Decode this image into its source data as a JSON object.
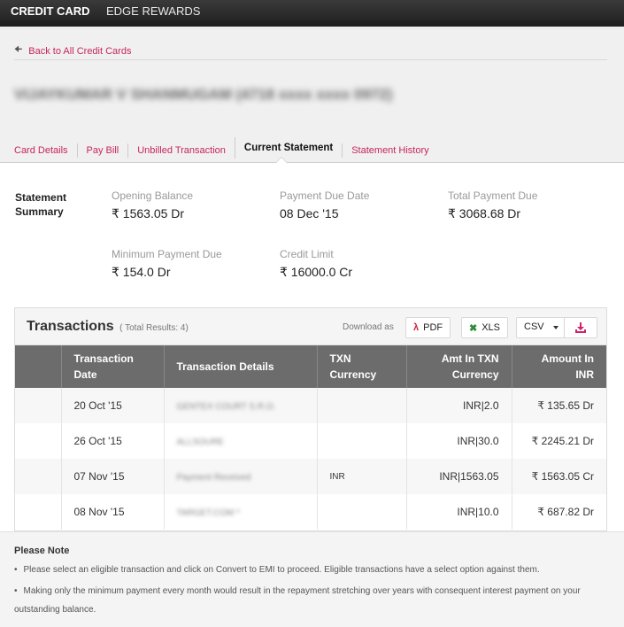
{
  "topnav": {
    "tabs": [
      {
        "label": "CREDIT CARD",
        "active": true
      },
      {
        "label": "EDGE REWARDS",
        "active": false
      }
    ]
  },
  "header": {
    "back_link": "Back to All Credit Cards",
    "card_name": "VIJAYKUMAR V SHANMUGAM (4718 xxxx xxxx 0972)",
    "subtabs": [
      {
        "label": "Card Details",
        "active": false
      },
      {
        "label": "Pay Bill",
        "active": false
      },
      {
        "label": "Unbilled Transaction",
        "active": false
      },
      {
        "label": "Current Statement",
        "active": true
      },
      {
        "label": "Statement History",
        "active": false
      }
    ]
  },
  "summary": {
    "title_line1": "Statement",
    "title_line2": "Summary",
    "items": [
      {
        "label": "Opening Balance",
        "value": "₹ 1563.05 Dr"
      },
      {
        "label": "Payment Due Date",
        "value": "08 Dec '15"
      },
      {
        "label": "Total Payment Due",
        "value": "₹ 3068.68 Dr"
      },
      {
        "label": "Minimum Payment Due",
        "value": "₹ 154.0 Dr"
      },
      {
        "label": "Credit Limit",
        "value": "₹ 16000.0 Cr"
      }
    ]
  },
  "transactions": {
    "title": "Transactions",
    "total_results": "( Total Results: 4)",
    "download_label": "Download as",
    "pdf_label": "PDF",
    "xls_label": "XLS",
    "format_selected": "CSV",
    "columns": [
      {
        "line1": "",
        "line2": ""
      },
      {
        "line1": "Transaction",
        "line2": "Date"
      },
      {
        "line1": "Transaction Details",
        "line2": ""
      },
      {
        "line1": "TXN",
        "line2": "Currency"
      },
      {
        "line1": "Amt In TXN",
        "line2": "Currency"
      },
      {
        "line1": "Amount In",
        "line2": "INR"
      }
    ],
    "rows": [
      {
        "date": "20 Oct '15",
        "details": "GENTEX COURT S.R.O.",
        "currency": "",
        "amt_txn": "INR|2.0",
        "amt_inr": "₹ 135.65 Dr"
      },
      {
        "date": "26 Oct '15",
        "details": "ALLSOURE",
        "currency": "",
        "amt_txn": "INR|30.0",
        "amt_inr": "₹ 2245.21 Dr"
      },
      {
        "date": "07 Nov '15",
        "details": "Payment Received",
        "currency": "INR",
        "amt_txn": "INR|1563.05",
        "amt_inr": "₹ 1563.05 Cr"
      },
      {
        "date": "08 Nov '15",
        "details": "TARGET.COM *",
        "currency": "",
        "amt_txn": "INR|10.0",
        "amt_inr": "₹ 687.82 Dr"
      }
    ]
  },
  "note": {
    "title": "Please Note",
    "items": [
      "Please select an eligible transaction and click on Convert to EMI to proceed. Eligible transactions have a select option against them.",
      "Making only the minimum payment every month would result in the repayment stretching over years with consequent interest payment on your outstanding balance."
    ]
  },
  "colors": {
    "accent": "#c8245d",
    "header_bg": "#6c6c6c",
    "topnav_bg": "#262626"
  }
}
